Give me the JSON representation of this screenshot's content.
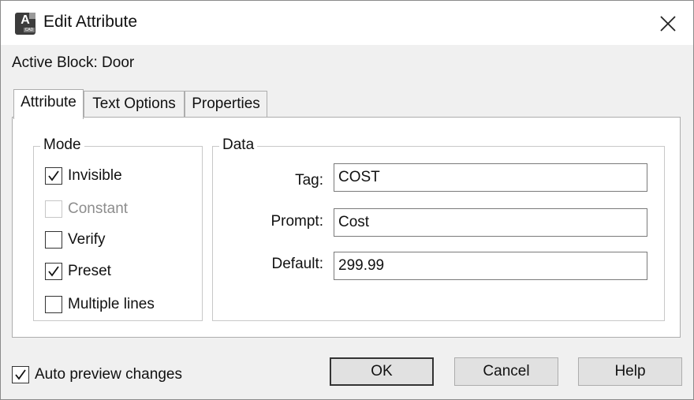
{
  "window": {
    "title": "Edit Attribute",
    "icon_letter": "A",
    "icon_sub": "CAD",
    "close_glyph": "close-icon"
  },
  "active_block": "Active Block: Door",
  "tabs": [
    {
      "label": "Attribute",
      "active": true
    },
    {
      "label": "Text Options",
      "active": false
    },
    {
      "label": "Properties",
      "active": false
    }
  ],
  "mode": {
    "legend": "Mode",
    "items": [
      {
        "label": "Invisible",
        "checked": true,
        "enabled": true
      },
      {
        "label": "Constant",
        "checked": false,
        "enabled": false
      },
      {
        "label": "Verify",
        "checked": false,
        "enabled": true
      },
      {
        "label": "Preset",
        "checked": true,
        "enabled": true
      },
      {
        "label": "Multiple lines",
        "checked": false,
        "enabled": true
      }
    ]
  },
  "data": {
    "legend": "Data",
    "fields": [
      {
        "label": "Tag:",
        "value": "COST"
      },
      {
        "label": "Prompt:",
        "value": "Cost"
      },
      {
        "label": "Default:",
        "value": "299.99"
      }
    ]
  },
  "footer": {
    "auto_preview_label": "Auto preview changes",
    "auto_preview_checked": true,
    "ok_label": "OK",
    "cancel_label": "Cancel",
    "help_label": "Help"
  },
  "colors": {
    "dialog_bg": "#f0f0f0",
    "panel_bg": "#ffffff",
    "disabled_text": "#8d8d8d"
  }
}
